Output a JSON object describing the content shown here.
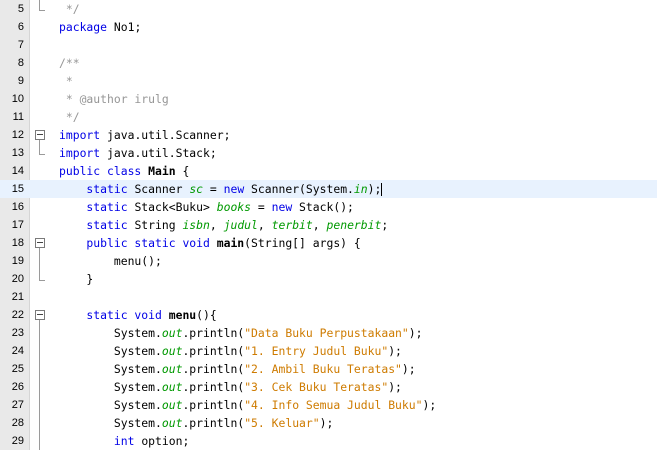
{
  "editor": {
    "lines": [
      {
        "num": "5",
        "parts": [
          {
            "t": " */",
            "c": "cm"
          }
        ],
        "fold": "end"
      },
      {
        "num": "6",
        "parts": [
          {
            "t": "package ",
            "c": "kw"
          },
          {
            "t": "No1;",
            "c": ""
          }
        ],
        "fold": ""
      },
      {
        "num": "7",
        "parts": [],
        "fold": ""
      },
      {
        "num": "8",
        "parts": [
          {
            "t": "/**",
            "c": "cm"
          }
        ],
        "fold": ""
      },
      {
        "num": "9",
        "parts": [
          {
            "t": " *",
            "c": "cm"
          }
        ],
        "fold": ""
      },
      {
        "num": "10",
        "parts": [
          {
            "t": " * @author irulg",
            "c": "cm"
          }
        ],
        "fold": ""
      },
      {
        "num": "11",
        "parts": [
          {
            "t": " */",
            "c": "cm"
          }
        ],
        "fold": ""
      },
      {
        "num": "12",
        "parts": [
          {
            "t": "import ",
            "c": "kw"
          },
          {
            "t": "java.util.Scanner;",
            "c": ""
          }
        ],
        "fold": "start"
      },
      {
        "num": "13",
        "parts": [
          {
            "t": "import ",
            "c": "kw"
          },
          {
            "t": "java.util.Stack;",
            "c": ""
          }
        ],
        "fold": "end"
      },
      {
        "num": "14",
        "parts": [
          {
            "t": "public class ",
            "c": "kw"
          },
          {
            "t": "Main",
            "c": "bd"
          },
          {
            "t": " {",
            "c": ""
          }
        ],
        "fold": ""
      },
      {
        "num": "15",
        "parts": [
          {
            "t": "    static ",
            "c": "kw"
          },
          {
            "t": "Scanner ",
            "c": ""
          },
          {
            "t": "sc",
            "c": "fd"
          },
          {
            "t": " = ",
            "c": ""
          },
          {
            "t": "new ",
            "c": "kw"
          },
          {
            "t": "Scanner(System.",
            "c": ""
          },
          {
            "t": "in",
            "c": "sf"
          },
          {
            "t": ");",
            "c": ""
          }
        ],
        "fold": "",
        "current": true
      },
      {
        "num": "16",
        "parts": [
          {
            "t": "    static ",
            "c": "kw"
          },
          {
            "t": "Stack<Buku> ",
            "c": ""
          },
          {
            "t": "books",
            "c": "fd"
          },
          {
            "t": " = ",
            "c": ""
          },
          {
            "t": "new ",
            "c": "kw"
          },
          {
            "t": "Stack();",
            "c": ""
          }
        ],
        "fold": ""
      },
      {
        "num": "17",
        "parts": [
          {
            "t": "    static ",
            "c": "kw"
          },
          {
            "t": "String ",
            "c": ""
          },
          {
            "t": "isbn",
            "c": "fd"
          },
          {
            "t": ", ",
            "c": ""
          },
          {
            "t": "judul",
            "c": "fd"
          },
          {
            "t": ", ",
            "c": ""
          },
          {
            "t": "terbit",
            "c": "fd"
          },
          {
            "t": ", ",
            "c": ""
          },
          {
            "t": "penerbit",
            "c": "fd"
          },
          {
            "t": ";",
            "c": ""
          }
        ],
        "fold": ""
      },
      {
        "num": "18",
        "parts": [
          {
            "t": "    public static void ",
            "c": "kw"
          },
          {
            "t": "main",
            "c": "bd"
          },
          {
            "t": "(String[] args) {",
            "c": ""
          }
        ],
        "fold": "start"
      },
      {
        "num": "19",
        "parts": [
          {
            "t": "        menu();",
            "c": ""
          }
        ],
        "fold": "mid"
      },
      {
        "num": "20",
        "parts": [
          {
            "t": "    }",
            "c": ""
          }
        ],
        "fold": "end"
      },
      {
        "num": "21",
        "parts": [],
        "fold": ""
      },
      {
        "num": "22",
        "parts": [
          {
            "t": "    static void ",
            "c": "kw"
          },
          {
            "t": "menu",
            "c": "bd"
          },
          {
            "t": "(){",
            "c": ""
          }
        ],
        "fold": "start"
      },
      {
        "num": "23",
        "parts": [
          {
            "t": "        System.",
            "c": ""
          },
          {
            "t": "out",
            "c": "sf"
          },
          {
            "t": ".println(",
            "c": ""
          },
          {
            "t": "\"Data Buku Perpustakaan\"",
            "c": "st"
          },
          {
            "t": ");",
            "c": ""
          }
        ],
        "fold": "mid"
      },
      {
        "num": "24",
        "parts": [
          {
            "t": "        System.",
            "c": ""
          },
          {
            "t": "out",
            "c": "sf"
          },
          {
            "t": ".println(",
            "c": ""
          },
          {
            "t": "\"1. Entry Judul Buku\"",
            "c": "st"
          },
          {
            "t": ");",
            "c": ""
          }
        ],
        "fold": "mid"
      },
      {
        "num": "25",
        "parts": [
          {
            "t": "        System.",
            "c": ""
          },
          {
            "t": "out",
            "c": "sf"
          },
          {
            "t": ".println(",
            "c": ""
          },
          {
            "t": "\"2. Ambil Buku Teratas\"",
            "c": "st"
          },
          {
            "t": ");",
            "c": ""
          }
        ],
        "fold": "mid"
      },
      {
        "num": "26",
        "parts": [
          {
            "t": "        System.",
            "c": ""
          },
          {
            "t": "out",
            "c": "sf"
          },
          {
            "t": ".println(",
            "c": ""
          },
          {
            "t": "\"3. Cek Buku Teratas\"",
            "c": "st"
          },
          {
            "t": ");",
            "c": ""
          }
        ],
        "fold": "mid"
      },
      {
        "num": "27",
        "parts": [
          {
            "t": "        System.",
            "c": ""
          },
          {
            "t": "out",
            "c": "sf"
          },
          {
            "t": ".println(",
            "c": ""
          },
          {
            "t": "\"4. Info Semua Judul Buku\"",
            "c": "st"
          },
          {
            "t": ");",
            "c": ""
          }
        ],
        "fold": "mid"
      },
      {
        "num": "28",
        "parts": [
          {
            "t": "        System.",
            "c": ""
          },
          {
            "t": "out",
            "c": "sf"
          },
          {
            "t": ".println(",
            "c": ""
          },
          {
            "t": "\"5. Keluar\"",
            "c": "st"
          },
          {
            "t": ");",
            "c": ""
          }
        ],
        "fold": "mid"
      },
      {
        "num": "29",
        "parts": [
          {
            "t": "        ",
            "c": ""
          },
          {
            "t": "int ",
            "c": "kw"
          },
          {
            "t": "option;",
            "c": ""
          }
        ],
        "fold": "mid"
      }
    ]
  },
  "colors": {
    "keyword": "#0000e6",
    "comment": "#969696",
    "string": "#ce7b00",
    "field": "#009900",
    "current_line": "#e8f2fe",
    "gutter": "#e9e9e9"
  }
}
